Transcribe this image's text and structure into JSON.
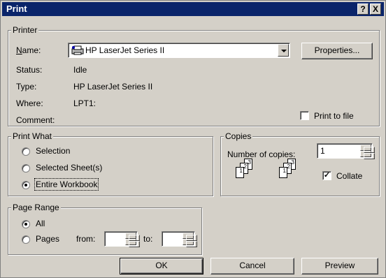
{
  "window": {
    "title": "Print",
    "help_icon": "?",
    "close_icon": "X"
  },
  "printer": {
    "legend": "Printer",
    "name_label": "Name:",
    "name_value": "HP LaserJet Series II",
    "printer_icon": "printer-icon",
    "properties_button": "Properties...",
    "status_label": "Status:",
    "status_value": "Idle",
    "type_label": "Type:",
    "type_value": "HP LaserJet Series II",
    "where_label": "Where:",
    "where_value": "LPT1:",
    "comment_label": "Comment:",
    "print_to_file_label": "Print to file",
    "print_to_file_checked": false
  },
  "print_what": {
    "legend": "Print What",
    "options": [
      "Selection",
      "Selected Sheet(s)",
      "Entire Workbook"
    ],
    "selected_index": 2
  },
  "copies": {
    "legend": "Copies",
    "number_label": "Number of copies:",
    "number_value": "1",
    "collate_label": "Collate",
    "collate_checked": true,
    "page_icons": [
      "1",
      "2",
      "3"
    ]
  },
  "page_range": {
    "legend": "Page Range",
    "all_label": "All",
    "pages_label": "Pages",
    "from_label": "from:",
    "to_label": "to:",
    "from_value": "",
    "to_value": "",
    "selected": "All"
  },
  "buttons": {
    "ok": "OK",
    "cancel": "Cancel",
    "preview": "Preview"
  }
}
